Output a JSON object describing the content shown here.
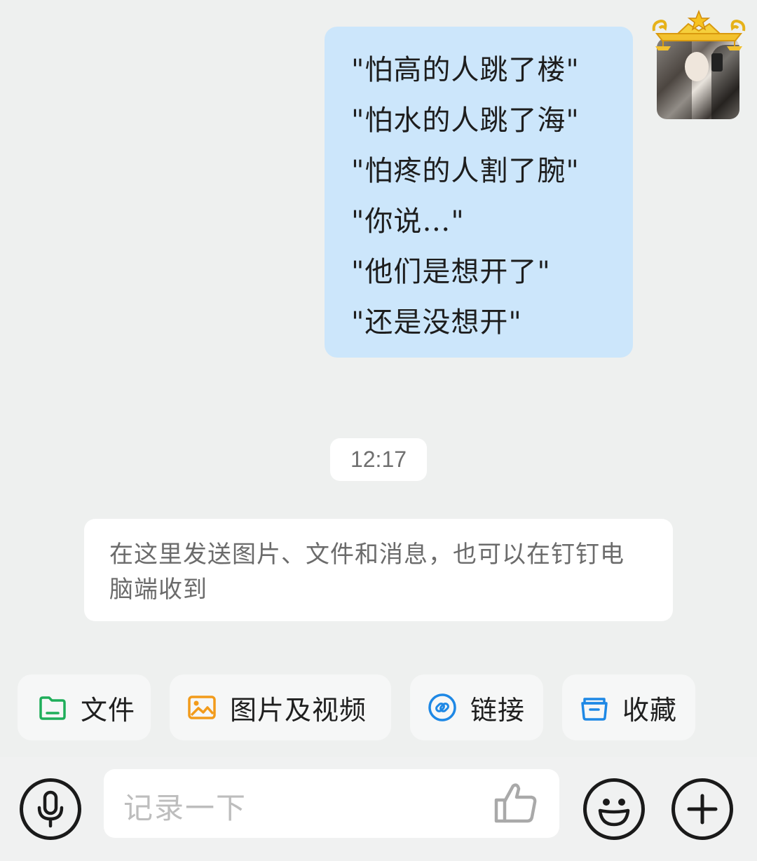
{
  "chat": {
    "outgoing_message": {
      "lines": [
        "\"怕高的人跳了楼\"",
        "\"怕水的人跳了海\"",
        "\"怕疼的人割了腕\"",
        "\"你说…\"",
        "\"他们是想开了\"",
        "\"还是没想开\""
      ]
    },
    "timestamp": "12:17",
    "system_notice": "在这里发送图片、文件和消息，也可以在钉钉电脑端收到"
  },
  "quick_actions": [
    {
      "label": "文件",
      "icon": "folder-icon",
      "color": "#1fae5a"
    },
    {
      "label": "图片及视频",
      "icon": "image-icon",
      "color": "#f29b1b"
    },
    {
      "label": "链接",
      "icon": "link-icon",
      "color": "#1e88e5"
    },
    {
      "label": "收藏",
      "icon": "favorites-box-icon",
      "color": "#1e88e5"
    }
  ],
  "input_bar": {
    "placeholder": "记录一下",
    "icons": [
      "microphone-icon",
      "thumbs-up-icon",
      "emoji-icon",
      "plus-icon"
    ]
  }
}
